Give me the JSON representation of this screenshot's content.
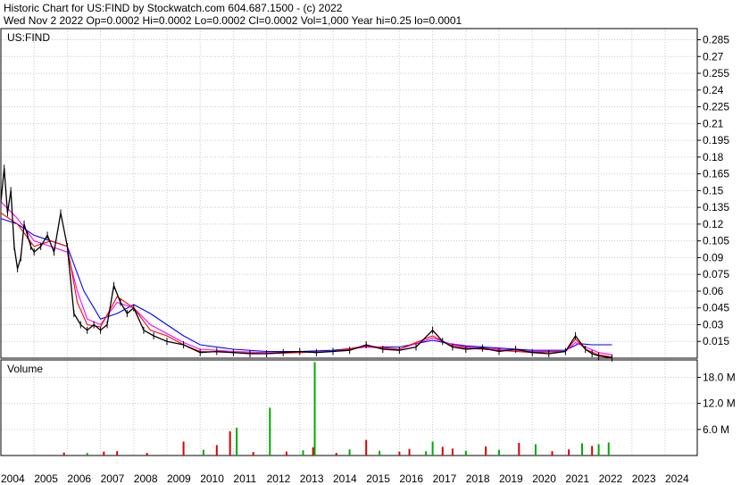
{
  "header": {
    "line1": "Historic Chart for US:FIND by Stockwatch.com 604.687.1500 - (c) 2022",
    "line2": "Wed Nov  2 2022   Op=0.0002  Hi=0.0002   Lo=0.0002   Cl=0.0002   Vol=1,000   Year hi=0.25   lo=0.0001"
  },
  "colors": {
    "price": "#000000",
    "ma_short": "#ff0000",
    "ma_mid": "#ff00ff",
    "ma_long": "#0000ff",
    "vol_up": "#00aa00",
    "vol_down": "#dd0000",
    "grid": "#c8c8c8"
  },
  "chart_data": [
    {
      "type": "line",
      "label": "US:FIND",
      "x_ticks": [
        "2004",
        "2005",
        "2006",
        "2007",
        "2008",
        "2009",
        "2010",
        "2011",
        "2012",
        "2013",
        "2014",
        "2015",
        "2016",
        "2017",
        "2018",
        "2019",
        "2020",
        "2021",
        "2022",
        "2023",
        "2024"
      ],
      "y_ticks": [
        "0.285",
        "0.27",
        "0.255",
        "0.24",
        "0.225",
        "0.21",
        "0.195",
        "0.18",
        "0.165",
        "0.15",
        "0.135",
        "0.12",
        "0.105",
        "0.09",
        "0.075",
        "0.06",
        "0.045",
        "0.03",
        "0.015"
      ],
      "ylim": [
        0,
        0.295
      ],
      "xlim": [
        2004,
        2024
      ],
      "grid": true,
      "series": [
        {
          "key": "price",
          "x": [
            2004.0,
            2004.1,
            2004.2,
            2004.3,
            2004.4,
            2004.5,
            2004.6,
            2004.7,
            2004.8,
            2004.9,
            2005.0,
            2005.2,
            2005.4,
            2005.6,
            2005.8,
            2006.0,
            2006.2,
            2006.4,
            2006.6,
            2006.8,
            2007.0,
            2007.2,
            2007.4,
            2007.6,
            2007.8,
            2008.0,
            2008.3,
            2008.6,
            2009.0,
            2009.5,
            2010.0,
            2010.5,
            2011.0,
            2011.5,
            2012.0,
            2012.5,
            2013.0,
            2013.5,
            2014.0,
            2014.5,
            2015.0,
            2015.5,
            2016.0,
            2016.5,
            2017.0,
            2017.3,
            2017.6,
            2018.0,
            2018.5,
            2019.0,
            2019.5,
            2020.0,
            2020.5,
            2021.0,
            2021.3,
            2021.6,
            2021.8,
            2022.0,
            2022.4
          ],
          "y": [
            0.14,
            0.17,
            0.13,
            0.15,
            0.1,
            0.08,
            0.09,
            0.12,
            0.11,
            0.1,
            0.095,
            0.1,
            0.11,
            0.095,
            0.13,
            0.1,
            0.04,
            0.03,
            0.025,
            0.03,
            0.025,
            0.03,
            0.065,
            0.05,
            0.04,
            0.045,
            0.025,
            0.02,
            0.015,
            0.012,
            0.005,
            0.006,
            0.005,
            0.004,
            0.004,
            0.005,
            0.006,
            0.005,
            0.006,
            0.007,
            0.012,
            0.008,
            0.007,
            0.01,
            0.025,
            0.015,
            0.01,
            0.008,
            0.009,
            0.006,
            0.008,
            0.005,
            0.004,
            0.006,
            0.02,
            0.008,
            0.004,
            0.002,
            0.0002
          ]
        },
        {
          "key": "ma_short",
          "x": [
            2004.0,
            2004.5,
            2005.0,
            2005.5,
            2006.0,
            2006.3,
            2006.6,
            2007.0,
            2007.5,
            2008.0,
            2008.5,
            2009.0,
            2009.5,
            2010.0,
            2011.0,
            2012.0,
            2013.0,
            2014.0,
            2015.0,
            2016.0,
            2017.0,
            2017.5,
            2018.0,
            2019.0,
            2020.0,
            2021.0,
            2021.3,
            2021.6,
            2022.0,
            2022.4
          ],
          "y": [
            0.13,
            0.12,
            0.1,
            0.105,
            0.1,
            0.05,
            0.03,
            0.028,
            0.055,
            0.045,
            0.025,
            0.02,
            0.012,
            0.006,
            0.005,
            0.004,
            0.005,
            0.006,
            0.011,
            0.008,
            0.02,
            0.012,
            0.009,
            0.007,
            0.005,
            0.006,
            0.017,
            0.008,
            0.003,
            0.001
          ]
        },
        {
          "key": "ma_mid",
          "x": [
            2004.0,
            2004.5,
            2005.0,
            2005.5,
            2006.0,
            2006.3,
            2006.6,
            2007.0,
            2007.5,
            2008.0,
            2008.5,
            2009.0,
            2009.5,
            2010.0,
            2011.0,
            2012.0,
            2013.0,
            2014.0,
            2015.0,
            2016.0,
            2017.0,
            2017.5,
            2018.0,
            2019.0,
            2020.0,
            2021.0,
            2021.3,
            2021.6,
            2022.0,
            2022.4
          ],
          "y": [
            0.14,
            0.125,
            0.105,
            0.1,
            0.095,
            0.06,
            0.035,
            0.03,
            0.05,
            0.045,
            0.03,
            0.022,
            0.014,
            0.008,
            0.006,
            0.005,
            0.005,
            0.006,
            0.01,
            0.008,
            0.018,
            0.013,
            0.01,
            0.008,
            0.006,
            0.006,
            0.014,
            0.01,
            0.005,
            0.003
          ]
        },
        {
          "key": "ma_long",
          "x": [
            2004.0,
            2004.5,
            2005.0,
            2005.5,
            2006.0,
            2006.5,
            2007.0,
            2007.5,
            2008.0,
            2008.5,
            2009.0,
            2009.5,
            2010.0,
            2011.0,
            2012.0,
            2013.0,
            2014.0,
            2015.0,
            2016.0,
            2017.0,
            2017.5,
            2018.0,
            2019.0,
            2020.0,
            2021.0,
            2021.4,
            2021.8,
            2022.4
          ],
          "y": [
            0.125,
            0.12,
            0.11,
            0.105,
            0.1,
            0.06,
            0.035,
            0.04,
            0.048,
            0.04,
            0.03,
            0.02,
            0.012,
            0.008,
            0.006,
            0.006,
            0.007,
            0.01,
            0.01,
            0.016,
            0.013,
            0.011,
            0.009,
            0.007,
            0.007,
            0.013,
            0.012,
            0.012
          ]
        }
      ]
    },
    {
      "type": "bar",
      "label": "Volume",
      "y_ticks": [
        "18.0 M",
        "12.0 M",
        "6.0 M"
      ],
      "ylim": [
        0,
        22
      ],
      "unit": "M",
      "grid": true,
      "spikes": [
        {
          "x": 2005.9,
          "v": 0.7,
          "up": false
        },
        {
          "x": 2006.6,
          "v": 0.6,
          "up": true
        },
        {
          "x": 2007.1,
          "v": 0.9,
          "up": false
        },
        {
          "x": 2007.5,
          "v": 1.0,
          "up": false
        },
        {
          "x": 2008.4,
          "v": 0.6,
          "up": false
        },
        {
          "x": 2009.5,
          "v": 3.2,
          "up": false
        },
        {
          "x": 2010.1,
          "v": 1.3,
          "up": true
        },
        {
          "x": 2010.5,
          "v": 2.4,
          "up": false
        },
        {
          "x": 2010.9,
          "v": 5.6,
          "up": false
        },
        {
          "x": 2011.1,
          "v": 6.4,
          "up": true
        },
        {
          "x": 2011.6,
          "v": 0.8,
          "up": false
        },
        {
          "x": 2012.1,
          "v": 11.0,
          "up": true
        },
        {
          "x": 2012.6,
          "v": 0.9,
          "up": false
        },
        {
          "x": 2013.1,
          "v": 1.2,
          "up": true
        },
        {
          "x": 2013.4,
          "v": 1.9,
          "up": false
        },
        {
          "x": 2013.45,
          "v": 21.5,
          "up": true
        },
        {
          "x": 2014.1,
          "v": 0.6,
          "up": false
        },
        {
          "x": 2014.5,
          "v": 1.4,
          "up": true
        },
        {
          "x": 2015.0,
          "v": 3.6,
          "up": false
        },
        {
          "x": 2015.4,
          "v": 1.1,
          "up": true
        },
        {
          "x": 2016.0,
          "v": 0.9,
          "up": false
        },
        {
          "x": 2016.3,
          "v": 1.5,
          "up": false
        },
        {
          "x": 2016.8,
          "v": 1.0,
          "up": true
        },
        {
          "x": 2017.0,
          "v": 3.2,
          "up": true
        },
        {
          "x": 2017.3,
          "v": 2.0,
          "up": false
        },
        {
          "x": 2017.6,
          "v": 1.6,
          "up": false
        },
        {
          "x": 2018.0,
          "v": 1.1,
          "up": true
        },
        {
          "x": 2018.6,
          "v": 2.1,
          "up": false
        },
        {
          "x": 2019.0,
          "v": 1.3,
          "up": true
        },
        {
          "x": 2019.6,
          "v": 2.9,
          "up": false
        },
        {
          "x": 2020.1,
          "v": 2.6,
          "up": true
        },
        {
          "x": 2020.6,
          "v": 1.0,
          "up": false
        },
        {
          "x": 2021.1,
          "v": 1.4,
          "up": false
        },
        {
          "x": 2021.5,
          "v": 2.8,
          "up": true
        },
        {
          "x": 2021.8,
          "v": 2.2,
          "up": false
        },
        {
          "x": 2022.0,
          "v": 2.6,
          "up": true
        },
        {
          "x": 2022.3,
          "v": 3.0,
          "up": true
        }
      ]
    }
  ]
}
